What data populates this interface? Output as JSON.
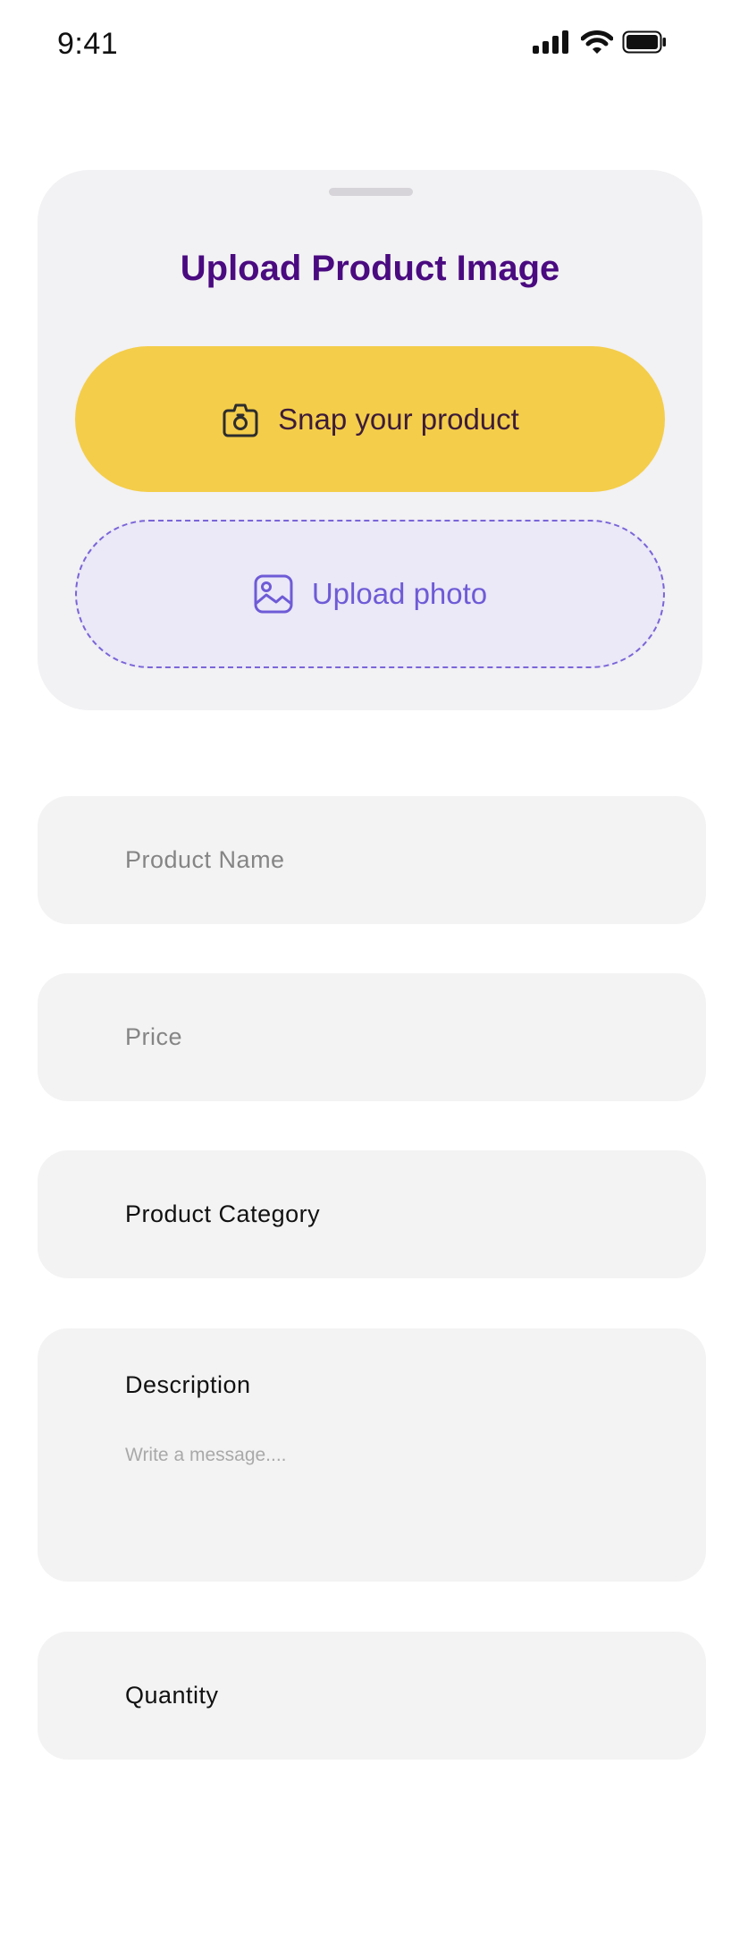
{
  "status_bar": {
    "time": "9:41",
    "icons": [
      "signal-icon",
      "wifi-icon",
      "battery-icon"
    ]
  },
  "upload_sheet": {
    "title": "Upload Product Image",
    "snap_button": {
      "label": "Snap your product",
      "icon": "camera-icon",
      "color": "#f4cd4a"
    },
    "upload_button": {
      "label": "Upload photo",
      "icon": "image-icon",
      "color": "#6e5bd6"
    }
  },
  "form": {
    "product_name": {
      "placeholder": "Product Name"
    },
    "price": {
      "placeholder": "Price"
    },
    "category": {
      "label": "Product Category"
    },
    "description": {
      "label": "Description",
      "placeholder": "Write a message...."
    },
    "quantity": {
      "label": "Quantity"
    }
  },
  "colors": {
    "title": "#4a0a80",
    "accent_yellow": "#f4cd4a",
    "accent_purple": "#6e5bd6",
    "sheet_bg": "#f2f1f3",
    "field_bg": "#f3f3f3"
  }
}
